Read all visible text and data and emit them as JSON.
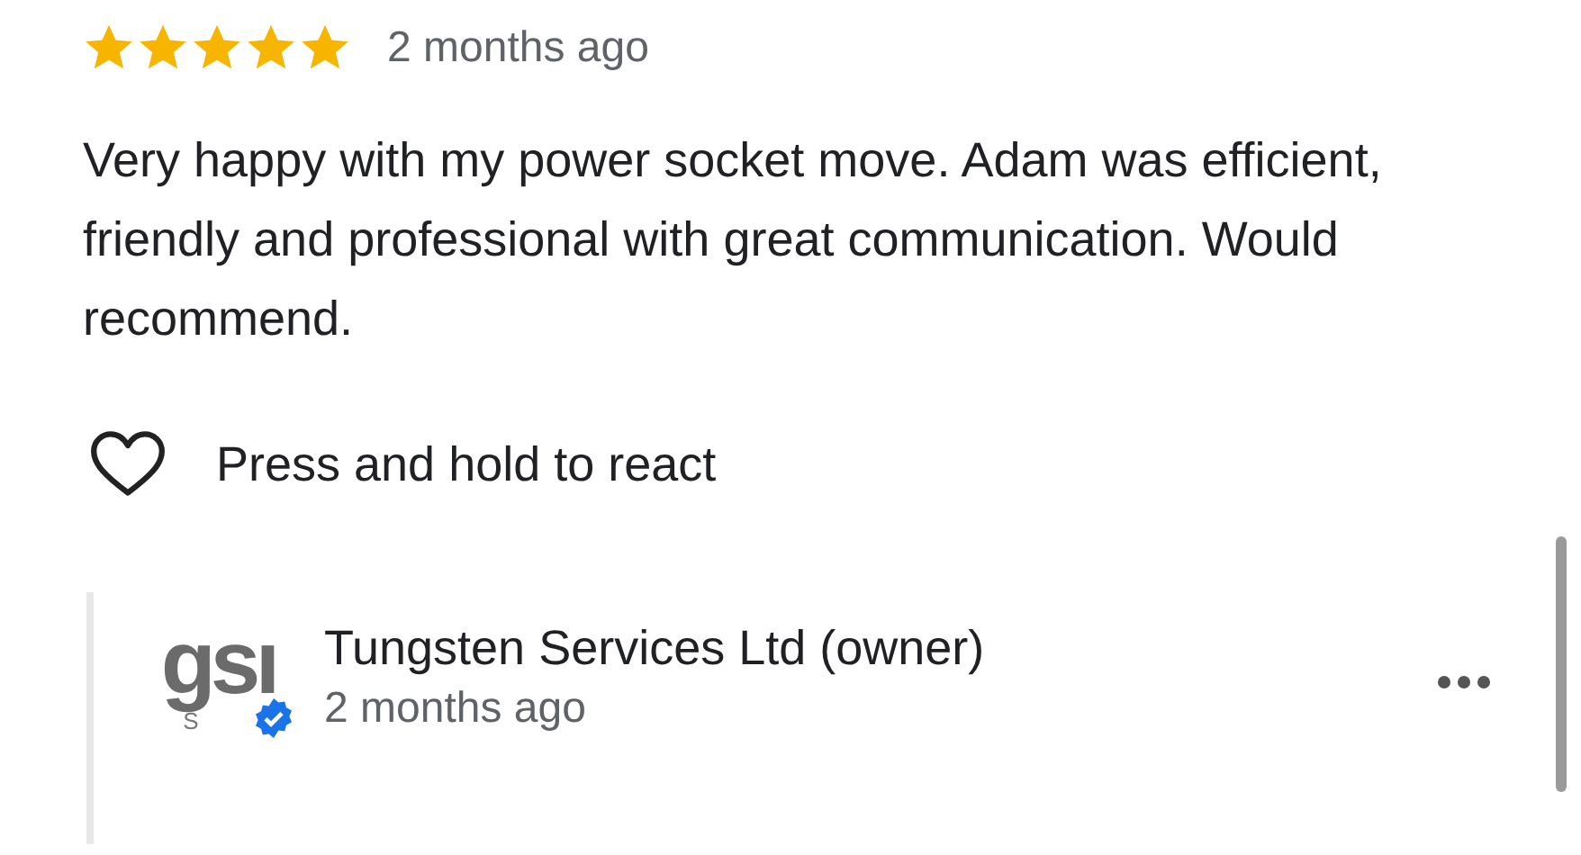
{
  "review": {
    "stars": 5,
    "time": "2 months ago",
    "text": "Very happy with my power socket move. Adam was efficient, friendly and professional with great communication. Would recommend.",
    "react_label": "Press and hold to react",
    "liked": false
  },
  "owner_reply": {
    "logo_text": "gsı",
    "logo_subtext": "S",
    "verified": true,
    "name": "Tungsten Services Ltd (owner)",
    "time": "2 months ago"
  }
}
